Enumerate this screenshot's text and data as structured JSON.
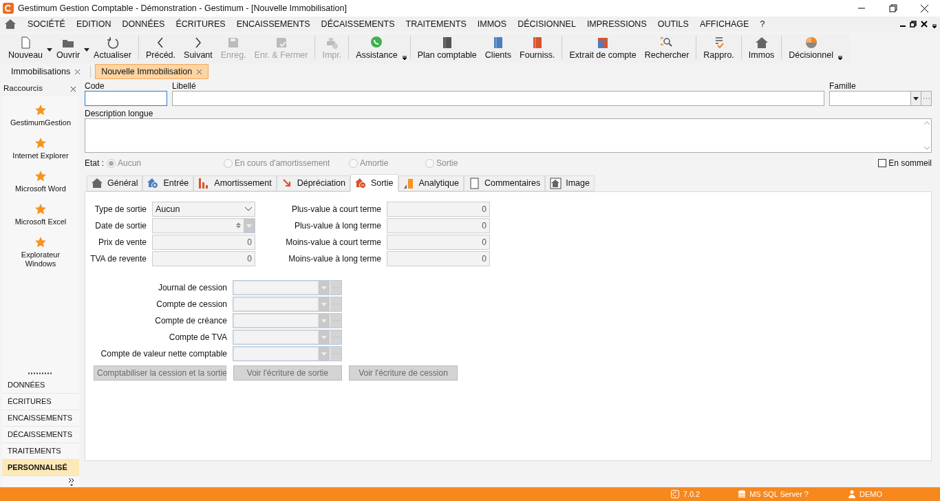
{
  "window": {
    "title": "Gestimum Gestion Comptable - Démonstration - Gestimum - [Nouvelle Immobilisation]"
  },
  "menu": [
    "SOCIÉTÉ",
    "EDITION",
    "DONNÉES",
    "ÉCRITURES",
    "ENCAISSEMENTS",
    "DÉCAISSEMENTS",
    "TRAITEMENTS",
    "IMMOS",
    "DÉCISIONNEL",
    "IMPRESSIONS",
    "OUTILS",
    "AFFICHAGE",
    "?"
  ],
  "toolbar": [
    [
      {
        "label": "Nouveau",
        "kind": "new",
        "disabled": false,
        "dropdown": true
      },
      {
        "label": "Ouvrir",
        "kind": "open",
        "disabled": false,
        "dropdown": true
      },
      {
        "label": "Actualiser",
        "kind": "refresh",
        "disabled": false,
        "dropdown": false
      }
    ],
    [
      {
        "label": "Précéd.",
        "kind": "prev",
        "disabled": false,
        "dropdown": false
      },
      {
        "label": "Suivant",
        "kind": "next",
        "disabled": false,
        "dropdown": false
      },
      {
        "label": "Enreg.",
        "kind": "save",
        "disabled": true,
        "dropdown": false
      },
      {
        "label": "Enr. & Fermer",
        "kind": "saveclose",
        "disabled": true,
        "dropdown": false
      }
    ],
    [
      {
        "label": "Impr.",
        "kind": "print",
        "disabled": true,
        "dropdown": false
      }
    ],
    [
      {
        "label": "Assistance",
        "kind": "chat",
        "disabled": false,
        "dropdown": false
      }
    ],
    [
      {
        "label": "Plan comptable",
        "kind": "bookdark",
        "disabled": false,
        "dropdown": false
      },
      {
        "label": "Clients",
        "kind": "bookblue",
        "disabled": false,
        "dropdown": false
      },
      {
        "label": "Fourniss.",
        "kind": "bookred",
        "disabled": false,
        "dropdown": false
      }
    ],
    [
      {
        "label": "Extrait de compte",
        "kind": "calendar",
        "disabled": false,
        "dropdown": false
      },
      {
        "label": "Rechercher",
        "kind": "search",
        "disabled": false,
        "dropdown": false
      }
    ],
    [
      {
        "label": "Rappro.",
        "kind": "check",
        "disabled": false,
        "dropdown": false
      }
    ],
    [
      {
        "label": "Immos",
        "kind": "house",
        "disabled": false,
        "dropdown": false
      }
    ],
    [
      {
        "label": "Décisionnel",
        "kind": "pie",
        "disabled": false,
        "dropdown": false
      }
    ]
  ],
  "doc_tabs": [
    {
      "label": "Immobilisations",
      "selected": false
    },
    {
      "label": "Nouvelle Immobilisation",
      "selected": true
    }
  ],
  "shortcuts": {
    "title": "Raccourcis",
    "items": [
      "GestimumGestion",
      "Internet Explorer",
      "Microsoft Word",
      "Microsoft Excel",
      "Explorateur Windows"
    ]
  },
  "nav": [
    {
      "label": "DONNÉES",
      "selected": false
    },
    {
      "label": "ÉCRITURES",
      "selected": false
    },
    {
      "label": "ENCAISSEMENTS",
      "selected": false
    },
    {
      "label": "DÉCAISSEMENTS",
      "selected": false
    },
    {
      "label": "TRAITEMENTS",
      "selected": false
    },
    {
      "label": "PERSONNALISÉ",
      "selected": true
    }
  ],
  "form": {
    "code": "Code",
    "libelle": "Libellé",
    "famille": "Famille",
    "description": "Description longue"
  },
  "etat": {
    "label": "Etat :",
    "options": [
      {
        "label": "Aucun",
        "selected": true,
        "disabled": true
      },
      {
        "label": "En cours d'amortissement",
        "selected": false,
        "disabled": true
      },
      {
        "label": "Amortie",
        "selected": false,
        "disabled": true
      },
      {
        "label": "Sortie",
        "selected": false,
        "disabled": true
      }
    ]
  },
  "en_sommeil": {
    "label": "En sommeil",
    "checked": false
  },
  "tabs": [
    {
      "label": "Général",
      "kind": "general",
      "selected": false
    },
    {
      "label": "Entrée",
      "kind": "entree",
      "selected": false
    },
    {
      "label": "Amortissement",
      "kind": "bars",
      "selected": false
    },
    {
      "label": "Dépréciation",
      "kind": "arrow",
      "selected": false
    },
    {
      "label": "Sortie",
      "kind": "sortie",
      "selected": true
    },
    {
      "label": "Analytique",
      "kind": "analytic",
      "selected": false
    },
    {
      "label": "Commentaires",
      "kind": "page",
      "selected": false
    },
    {
      "label": "Image",
      "kind": "image",
      "selected": false
    }
  ],
  "sortie": {
    "left": [
      {
        "label": "Type de sortie",
        "kind": "select",
        "value": "Aucun"
      },
      {
        "label": "Date de sortie",
        "kind": "date"
      },
      {
        "label": "Prix de vente",
        "kind": "number",
        "value": "0"
      },
      {
        "label": "TVA de revente",
        "kind": "number",
        "value": "0"
      }
    ],
    "right": [
      {
        "label": "Plus-value à court terme",
        "kind": "number",
        "value": "0"
      },
      {
        "label": "Plus-value à long terme",
        "kind": "number",
        "value": "0"
      },
      {
        "label": "Moins-value à court terme",
        "kind": "number",
        "value": "0"
      },
      {
        "label": "Moins-value à long terme",
        "kind": "number",
        "value": "0"
      }
    ],
    "accounts": [
      "Journal de cession",
      "Compte de cession",
      "Compte de créance",
      "Compte de TVA",
      "Compte de valeur nette comptable"
    ],
    "buttons": [
      {
        "label": "Comptabiliser la cession et la sortie",
        "disabled": true
      },
      {
        "label": "Voir l'écriture de sortie",
        "disabled": true
      },
      {
        "label": "Voir l'écriture de cession",
        "disabled": true
      }
    ]
  },
  "status_bar": {
    "version": "7.0.2",
    "server": "MS SQL Server ?",
    "user": "DEMO"
  }
}
